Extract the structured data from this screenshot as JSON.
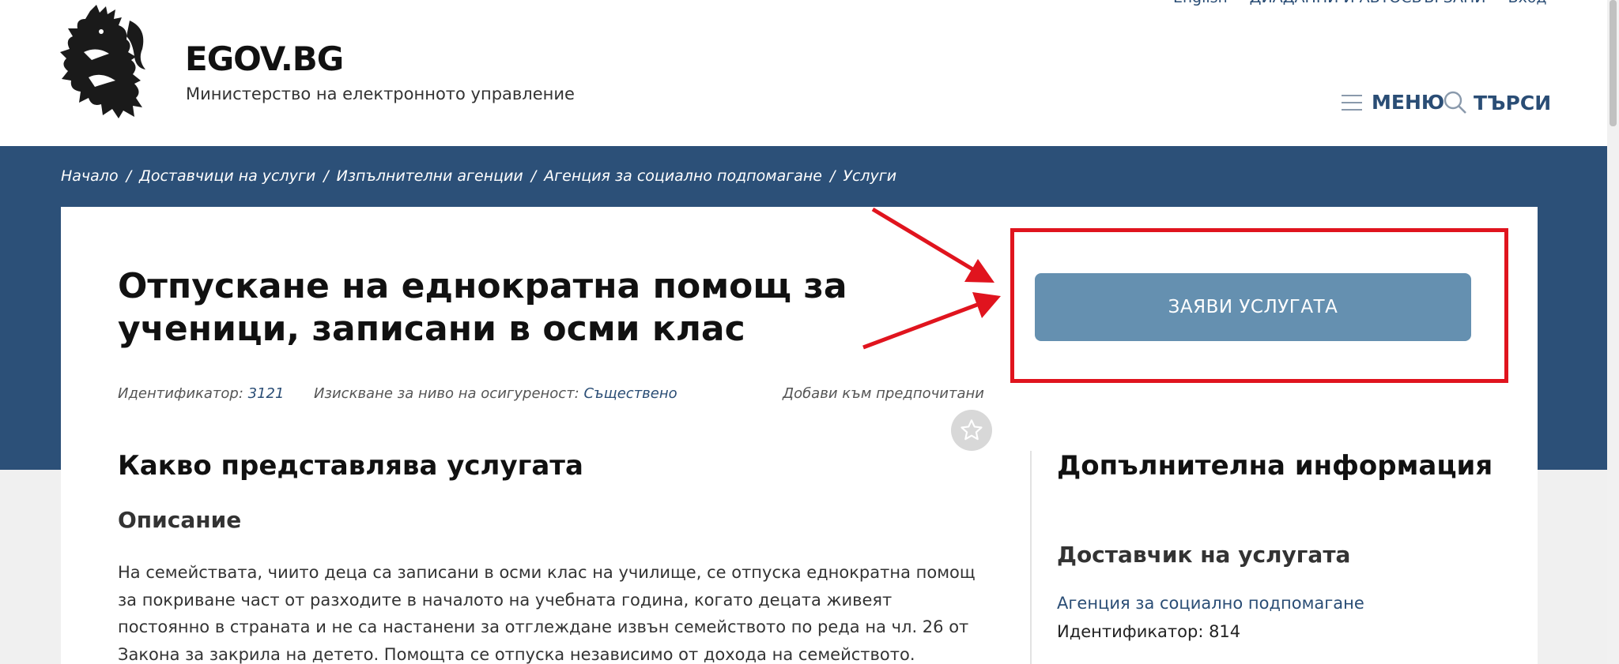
{
  "header": {
    "site_title": "EGOV.BG",
    "site_subtitle": "Министерство на електронното управление",
    "menu_label": "МЕНЮ",
    "search_label": "ТЪРСИ",
    "top_links": [
      "English",
      "ДИАДАННИ И АВТОСВЪРЗАНИ",
      "Вход"
    ]
  },
  "breadcrumb": {
    "items": [
      "Начало",
      "Доставчици на услуги",
      "Изпълнителни агенции",
      "Агенция за социално подпомагане",
      "Услуги"
    ]
  },
  "service": {
    "title": "Отпускане на еднократна помощ за ученици, записани в осми клас",
    "id_label": "Идентификатор:",
    "id_value": "3121",
    "level_label": "Изискване за ниво на осигуреност:",
    "level_value": "Съществено",
    "favorite_label": "Добави към предпочитани",
    "apply_label": "ЗАЯВИ УСЛУГАТА"
  },
  "main": {
    "heading": "Какво представлява услугата",
    "description_heading": "Описание",
    "description_text": "На семействата, чиито деца са записани в осми клас на училище, се отпуска еднократна помощ за покриване част от разходите в началото на учебната година, когато децата живеят постоянно в страната и не са настанени за отглеждане извън семейството по реда на чл. 26 от Закона за закрила на детето. Помощта се отпуска независимо от дохода на семейството."
  },
  "aside": {
    "heading": "Допълнителна информация",
    "provider_heading": "Доставчик на услугата",
    "provider_name": "Агенция за социално подпомагане",
    "provider_id": "Идентификатор: 814"
  },
  "colors": {
    "band": "#2c5078",
    "link": "#2a4d75",
    "apply_button": "#6590b0",
    "annotation_red": "#e0141e"
  },
  "icons": [
    "lion-coat-of-arms-logo",
    "hamburger-menu-icon",
    "search-icon",
    "star-icon"
  ]
}
